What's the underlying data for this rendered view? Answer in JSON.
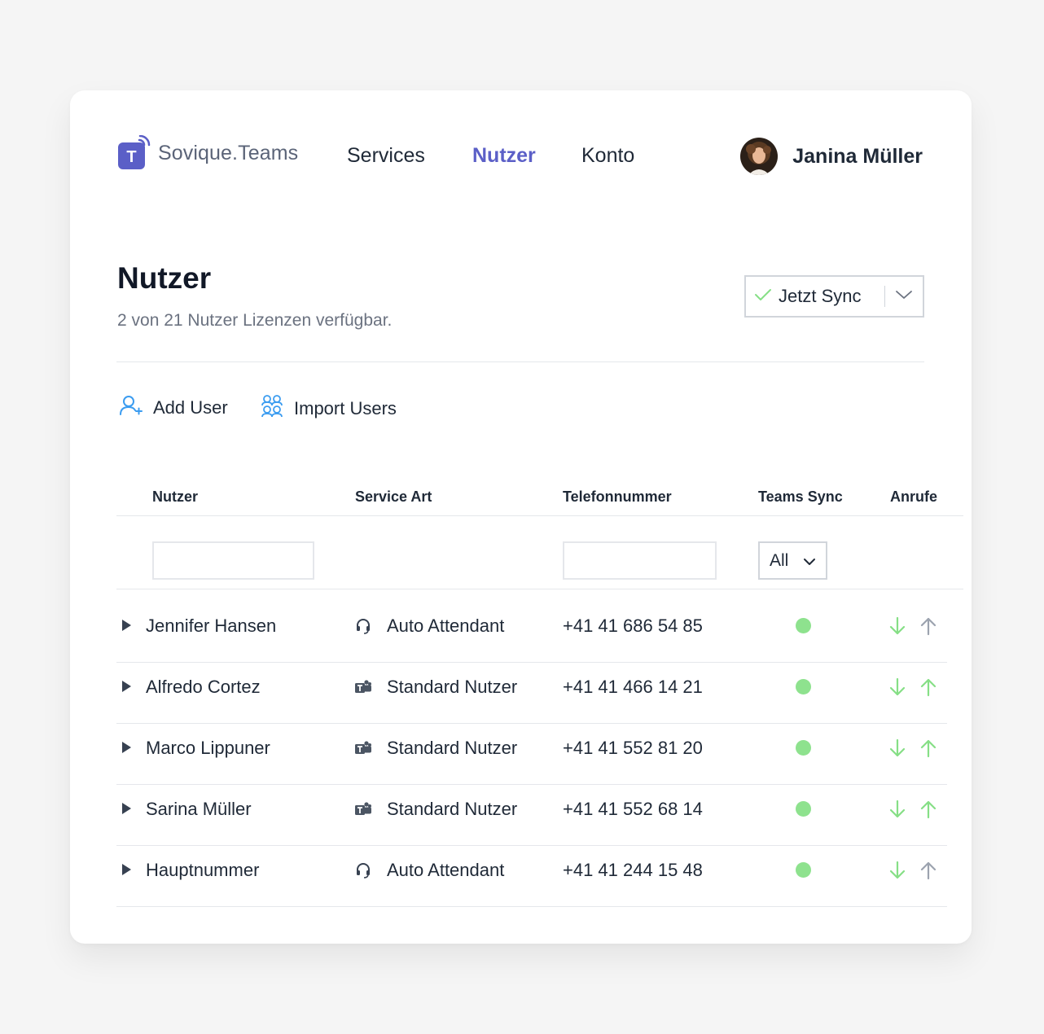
{
  "brand": {
    "name": "Sovique.Teams",
    "logo_letter": "T",
    "accent": "#5b5fc7"
  },
  "nav": {
    "items": [
      {
        "label": "Services",
        "active": false
      },
      {
        "label": "Nutzer",
        "active": true
      },
      {
        "label": "Konto",
        "active": false
      }
    ]
  },
  "user": {
    "name": "Janina Müller"
  },
  "page": {
    "title": "Nutzer",
    "subtitle": "2 von 21 Nutzer Lizenzen verfügbar.",
    "sync_button": "Jetzt Sync"
  },
  "actions": {
    "add_user": "Add User",
    "import_users": "Import Users"
  },
  "table": {
    "headers": {
      "user": "Nutzer",
      "service": "Service Art",
      "phone": "Telefonnummer",
      "sync": "Teams Sync",
      "calls": "Anrufe"
    },
    "filters": {
      "user_value": "",
      "phone_value": "",
      "sync_select": "All"
    },
    "rows": [
      {
        "name": "Jennifer Hansen",
        "service": "Auto Attendant",
        "service_icon": "headset-icon",
        "phone": "+41 41 686 54 85",
        "sync": "green",
        "in_active": true,
        "out_active": false
      },
      {
        "name": "Alfredo Cortez",
        "service": "Standard Nutzer",
        "service_icon": "teams-icon",
        "phone": "+41 41 466 14 21",
        "sync": "green",
        "in_active": true,
        "out_active": true
      },
      {
        "name": "Marco Lippuner",
        "service": "Standard Nutzer",
        "service_icon": "teams-icon",
        "phone": "+41 41 552 81 20",
        "sync": "green",
        "in_active": true,
        "out_active": true
      },
      {
        "name": "Sarina Müller",
        "service": "Standard Nutzer",
        "service_icon": "teams-icon",
        "phone": "+41 41 552 68 14",
        "sync": "green",
        "in_active": true,
        "out_active": true
      },
      {
        "name": "Hauptnummer",
        "service": "Auto Attendant",
        "service_icon": "headset-icon",
        "phone": "+41 41 244 15 48",
        "sync": "green",
        "in_active": true,
        "out_active": false
      }
    ]
  },
  "colors": {
    "status_green": "#8ee28e",
    "arrow_green": "#86df86",
    "arrow_gray": "#9ca3af",
    "icon_blue": "#3b9cf0"
  }
}
